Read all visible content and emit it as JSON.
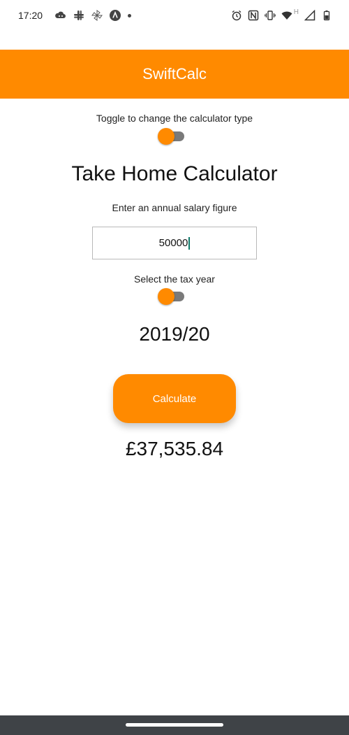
{
  "status_bar": {
    "time": "17:20",
    "left_icons": [
      "cloud-game-icon",
      "slack-icon",
      "pinwheel-icon",
      "app-a-icon",
      "more-dot-icon"
    ],
    "right_icons": [
      "alarm-icon",
      "nfc-icon",
      "vibrate-icon",
      "wifi-icon",
      "signal-icon",
      "battery-icon"
    ],
    "network_label": "H"
  },
  "app_bar": {
    "title": "SwiftCalc",
    "color": "#ff8a00"
  },
  "calculator_type": {
    "caption": "Toggle to change the calculator type",
    "toggle_on": false
  },
  "main": {
    "title": "Take Home Calculator",
    "salary_caption": "Enter an annual salary figure",
    "salary_value": "50000",
    "tax_caption": "Select the tax year",
    "tax_toggle_on": false,
    "tax_year": "2019/20",
    "calculate_label": "Calculate",
    "result": "£37,535.84"
  }
}
